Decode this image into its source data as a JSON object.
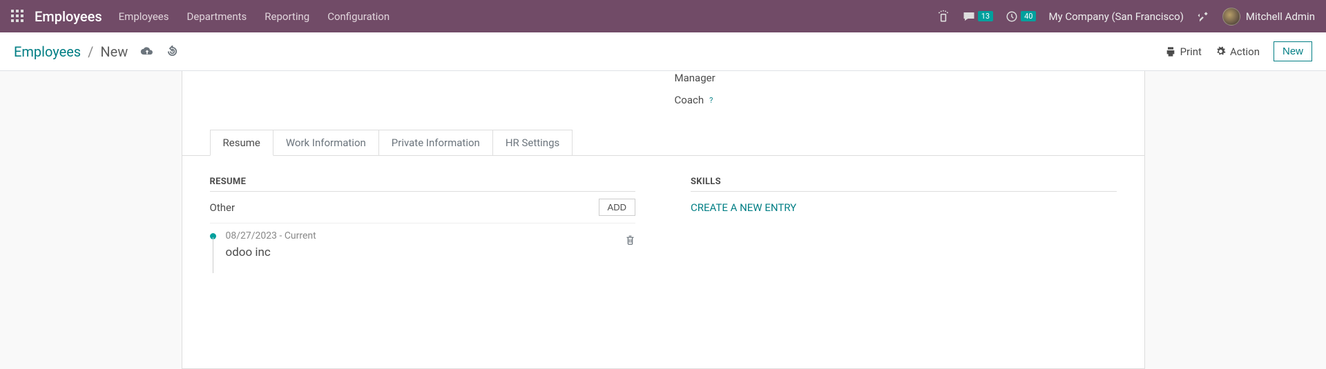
{
  "navbar": {
    "brand": "Employees",
    "menu": [
      "Employees",
      "Departments",
      "Reporting",
      "Configuration"
    ],
    "messages_badge": "13",
    "activities_badge": "40",
    "company": "My Company (San Francisco)",
    "user": "Mitchell Admin"
  },
  "controlbar": {
    "root": "Employees",
    "sep": "/",
    "current": "New",
    "print": "Print",
    "action": "Action",
    "new": "New"
  },
  "form": {
    "manager_label": "Manager",
    "coach_label": "Coach"
  },
  "tabs": [
    "Resume",
    "Work Information",
    "Private Information",
    "HR Settings"
  ],
  "resume": {
    "section": "RESUME",
    "group": "Other",
    "add": "ADD",
    "items": [
      {
        "date": "08/27/2023 - Current",
        "title": "odoo inc"
      }
    ]
  },
  "skills": {
    "section": "SKILLS",
    "create": "CREATE A NEW ENTRY"
  }
}
